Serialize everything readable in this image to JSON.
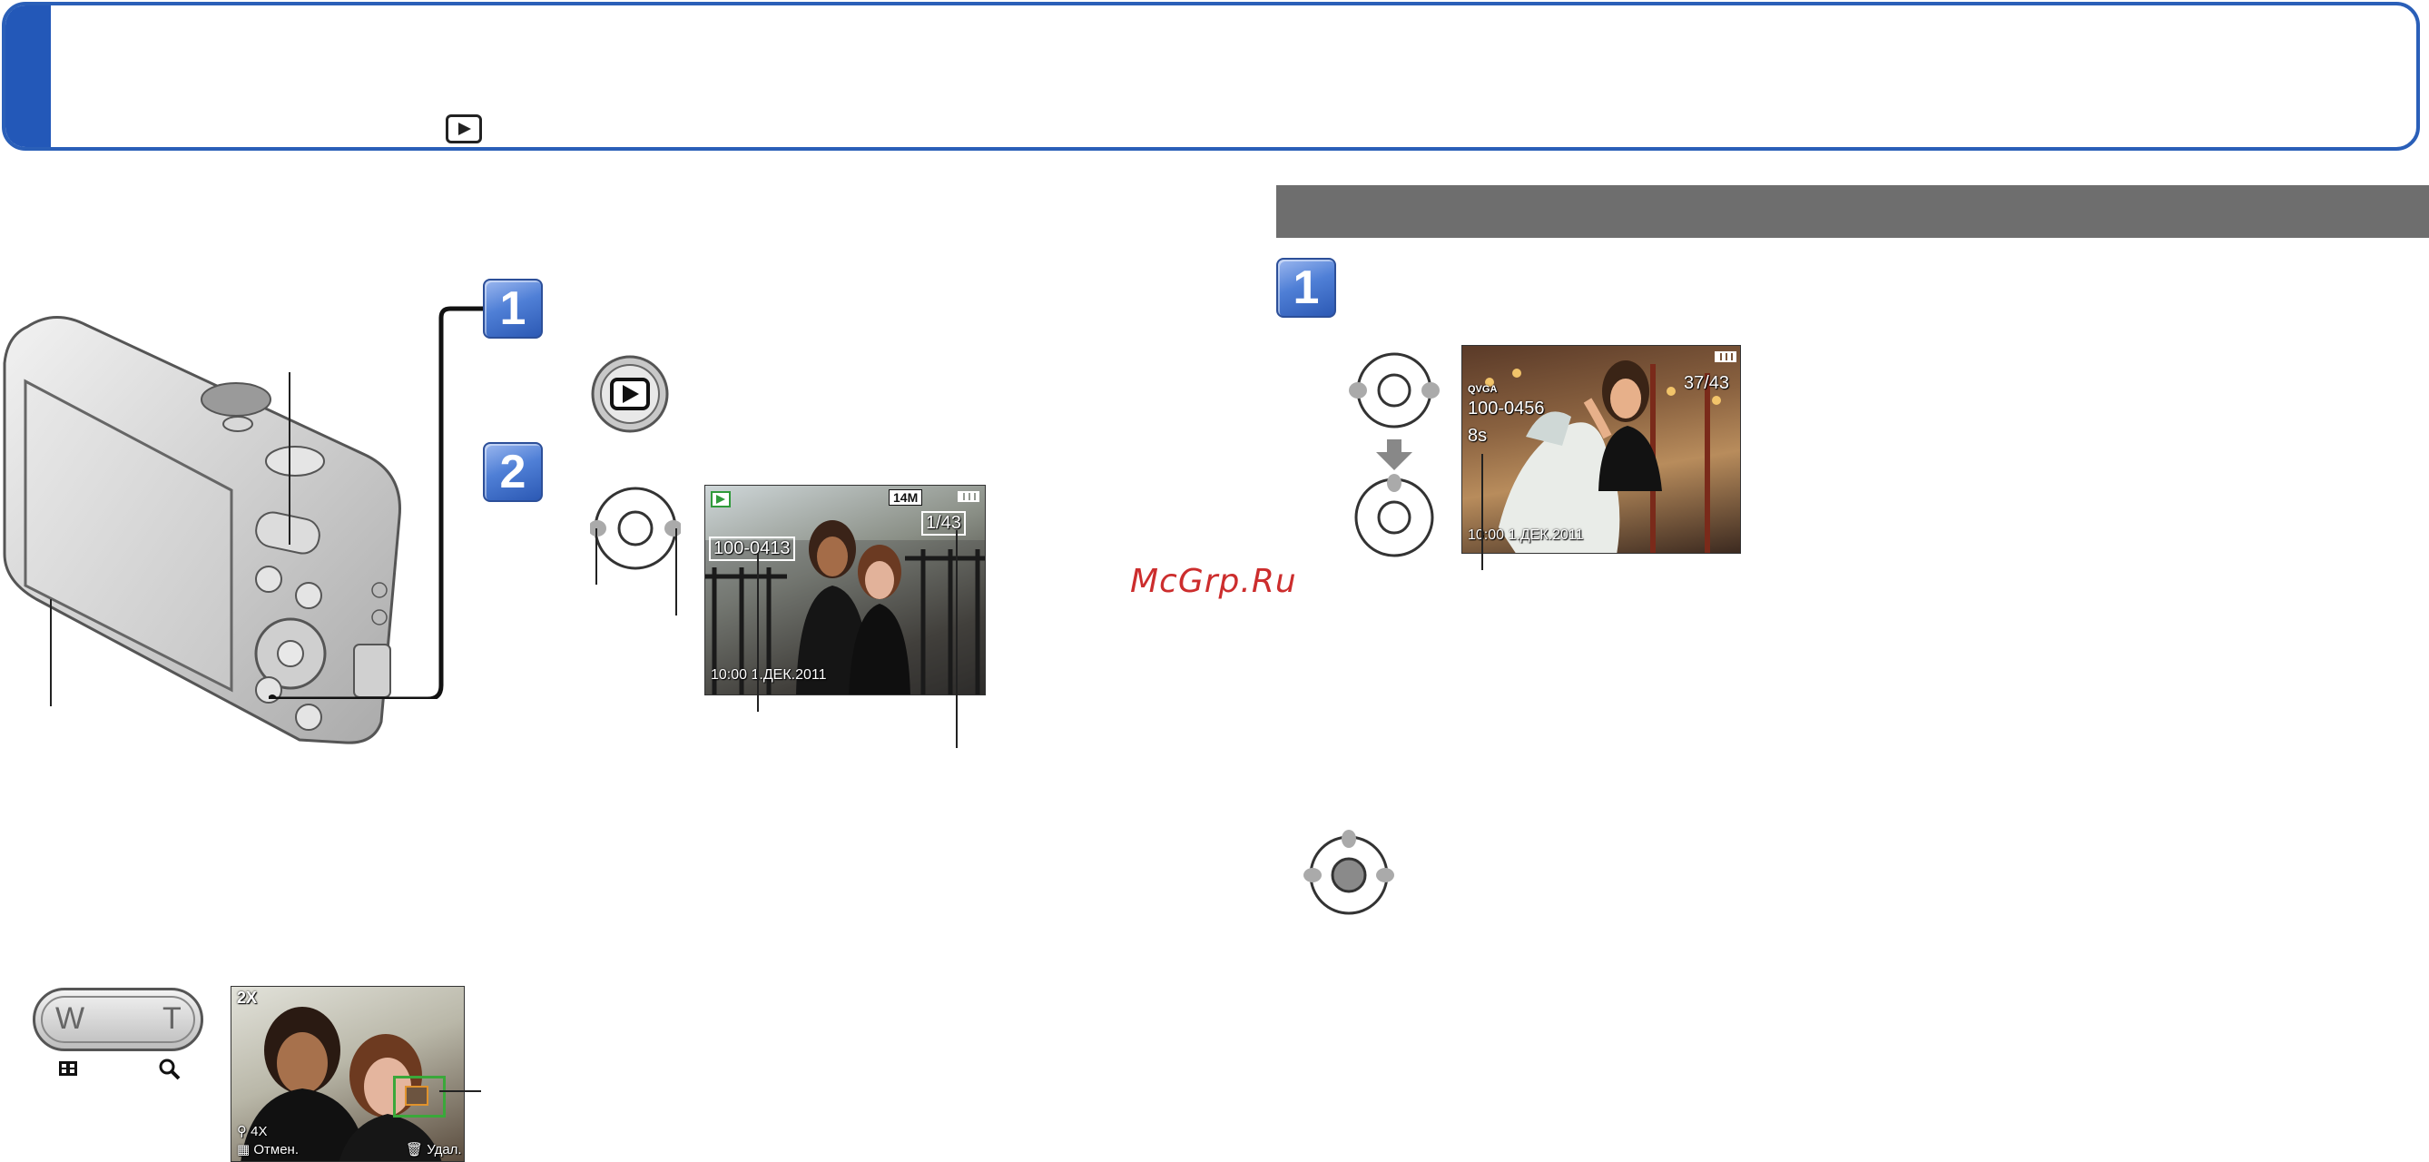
{
  "watermark": "McGrp.Ru",
  "steps": {
    "one": "1",
    "two": "2"
  },
  "playback_screen": {
    "date": "10:00  1.ДЕК.2011",
    "file_no": "100-0413",
    "counter": "1/43",
    "size": "14M"
  },
  "zoom": {
    "w_label": "W",
    "t_label": "T",
    "level": "2X",
    "magnify": "4X",
    "cancel": "Отмен.",
    "delete": "Удал."
  },
  "video_screen": {
    "format": "QVGA",
    "file_no": "100-0456",
    "duration": "8s",
    "counter": "37/43",
    "date": "10:00  1.ДЕК.2011"
  },
  "colors": {
    "header_blue": "#2358b8",
    "section_gray": "#6e6e6e",
    "badge_blue": "#4f7fd6",
    "watermark_red": "#cc2d2d"
  }
}
